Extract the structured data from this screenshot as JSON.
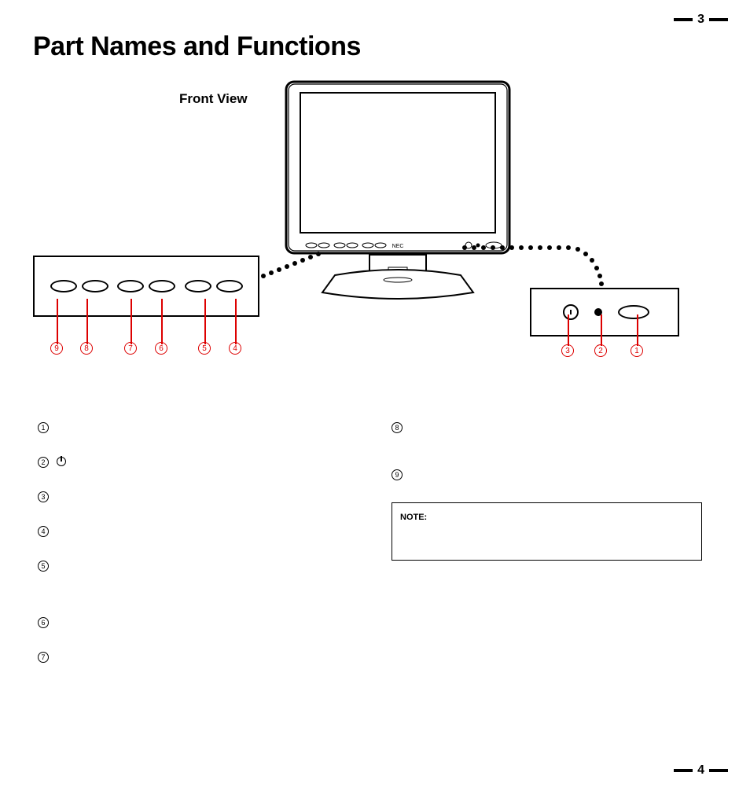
{
  "page_number_top": "3",
  "page_number_bottom": "4",
  "title": "Part Names and Functions",
  "front_view_label": "Front View",
  "monitor_brand": "NEC",
  "callouts_left": [
    "9",
    "8",
    "7",
    "6",
    "5",
    "4"
  ],
  "callouts_right": [
    "3",
    "2",
    "1"
  ],
  "left_column": [
    {
      "num": "1",
      "text": ""
    },
    {
      "num": "2",
      "text": ""
    },
    {
      "num": "3",
      "text": ""
    },
    {
      "num": "4",
      "text": ""
    },
    {
      "num": "5",
      "text": ""
    },
    {
      "num": "6",
      "text": ""
    },
    {
      "num": "7",
      "text": ""
    }
  ],
  "right_column": [
    {
      "num": "8",
      "text": ""
    },
    {
      "num": "9",
      "text": ""
    }
  ],
  "note_label": "NOTE:",
  "note_body": ""
}
